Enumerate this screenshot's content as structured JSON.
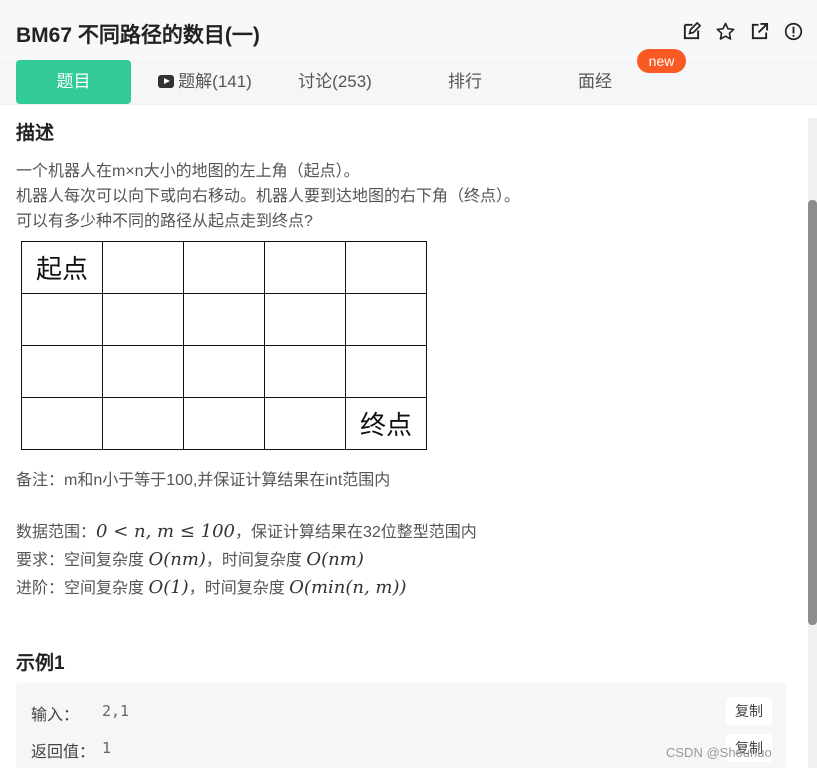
{
  "header": {
    "title": "BM67  不同路径的数目(一)",
    "icons": [
      "edit-icon",
      "star-icon",
      "external-link-icon",
      "info-icon"
    ]
  },
  "tabs": [
    {
      "label": "题目",
      "active": true
    },
    {
      "label": "题解(141)",
      "icon": "video-play-icon"
    },
    {
      "label": "讨论(253)"
    },
    {
      "label": "排行"
    },
    {
      "label": "面经",
      "badge": "new"
    }
  ],
  "description": {
    "heading": "描述",
    "lines": [
      "一个机器人在m×n大小的地图的左上角（起点）。",
      "机器人每次可以向下或向右移动。机器人要到达地图的右下角（终点）。",
      "可以有多少种不同的路径从起点走到终点?"
    ],
    "grid": {
      "start": "起点",
      "end": "终点",
      "rows": 4,
      "cols": 5
    },
    "note": "备注：m和n小于等于100,并保证计算结果在int范围内",
    "range_prefix": "数据范围：",
    "range_math": "0 < n, m ≤ 100",
    "range_suffix": "，保证计算结果在32位整型范围内",
    "req_prefix": "要求：空间复杂度 ",
    "req_math1": "O(nm)",
    "req_mid": "，时间复杂度 ",
    "req_math2": "O(nm)",
    "adv_prefix": "进阶：空间复杂度 ",
    "adv_math1": "O(1)",
    "adv_mid": "，时间复杂度 ",
    "adv_math2": "O(min(n, m))"
  },
  "example": {
    "heading": "示例1",
    "input_label": "输入：",
    "input_value": "2,1",
    "output_label": "返回值：",
    "output_value": "1",
    "copy_label": "复制"
  },
  "watermark": "CSDN @Shounuo"
}
